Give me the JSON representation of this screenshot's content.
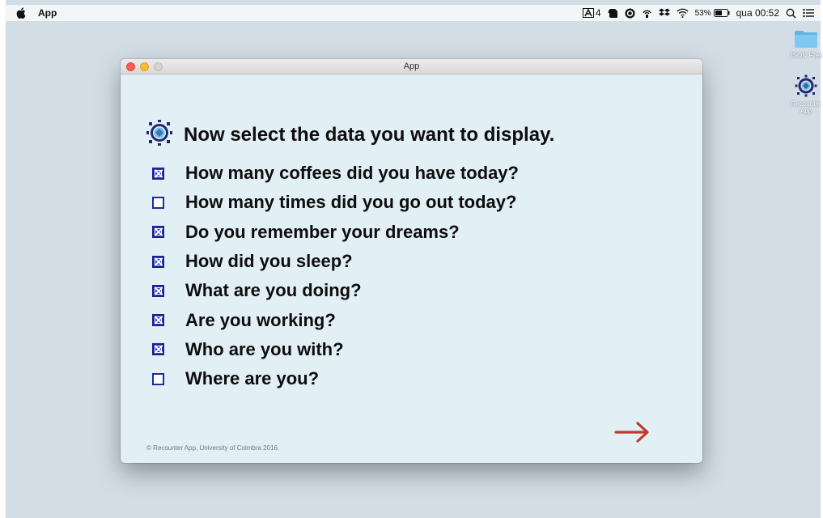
{
  "menubar": {
    "app_name": "App",
    "adobe_count": "4",
    "battery": "53%",
    "clock": "qua 00:52",
    "icons": [
      "apple-icon",
      "adobe-icon",
      "evernote-icon",
      "status-icon",
      "airdrop-icon",
      "dropbox-icon",
      "wifi-icon",
      "battery-icon",
      "spotlight-icon",
      "notification-center-icon"
    ]
  },
  "desktop": {
    "items": [
      {
        "label": "JSON Files",
        "icon": "folder-icon"
      },
      {
        "label": "Recounter App",
        "icon": "recounter-app-icon"
      }
    ]
  },
  "window": {
    "title": "App",
    "heading": "Now select the data you want to display.",
    "questions": [
      {
        "label": "How many coffees did you have today?",
        "checked": true
      },
      {
        "label": "How many times did you go out today?",
        "checked": false
      },
      {
        "label": "Do you remember your dreams?",
        "checked": true
      },
      {
        "label": "How did you sleep?",
        "checked": true
      },
      {
        "label": "What are you doing?",
        "checked": true
      },
      {
        "label": "Are you working?",
        "checked": true
      },
      {
        "label": "Who are you with?",
        "checked": true
      },
      {
        "label": "Where are you?",
        "checked": false
      }
    ],
    "footer": "© Recounter App, University of Coimbra 2016.",
    "next_icon": "arrow-right-icon"
  },
  "colors": {
    "window_bg": "#e2eff5",
    "desktop_bg": "#d3dde6",
    "checkbox": "#2a37b8",
    "arrow": "#c0392b"
  }
}
